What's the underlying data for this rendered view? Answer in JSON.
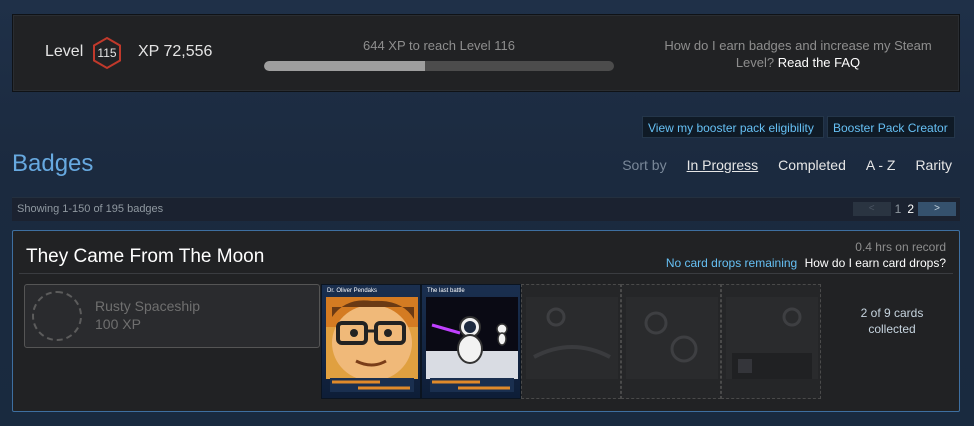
{
  "level_panel": {
    "level_label": "Level",
    "level_value": "115",
    "xp_label": "XP 72,556",
    "xp_next": "644 XP to reach Level 116",
    "xp_progress": 0.46,
    "faq_prefix": "How do I earn badges and increase my Steam Level?",
    "faq_link": "Read the FAQ",
    "colors": {
      "hex_border": "#c0392b",
      "bar_fill": "#9e9e9e"
    }
  },
  "buttons": {
    "booster_eligibility": "View my booster pack eligibility",
    "booster_creator": "Booster Pack Creator"
  },
  "badges": {
    "title": "Badges",
    "sort_label": "Sort by",
    "sort_options": [
      "In Progress",
      "Completed",
      "A - Z",
      "Rarity"
    ],
    "sort_active": "In Progress"
  },
  "showing": {
    "text": "Showing 1-150 of 195 badges",
    "pages": [
      "1",
      "2"
    ],
    "current_page": "2",
    "prev_icon": "<",
    "next_icon": ">"
  },
  "badge_row": {
    "game_title": "They Came From The Moon",
    "hours": "0.4 hrs on record",
    "no_drops": "No card drops remaining",
    "how_earn": "How do I earn card drops?",
    "badge_name": "Rusty Spaceship",
    "badge_xp": "100 XP",
    "cards": [
      {
        "title": "Dr. Oliver Pendaks",
        "owned": true
      },
      {
        "title": "The last battle",
        "owned": true
      },
      {
        "title": "",
        "owned": false
      },
      {
        "title": "",
        "owned": false
      },
      {
        "title": "",
        "owned": false
      }
    ],
    "collected_line1": "2 of 9 cards",
    "collected_line2": "collected"
  }
}
